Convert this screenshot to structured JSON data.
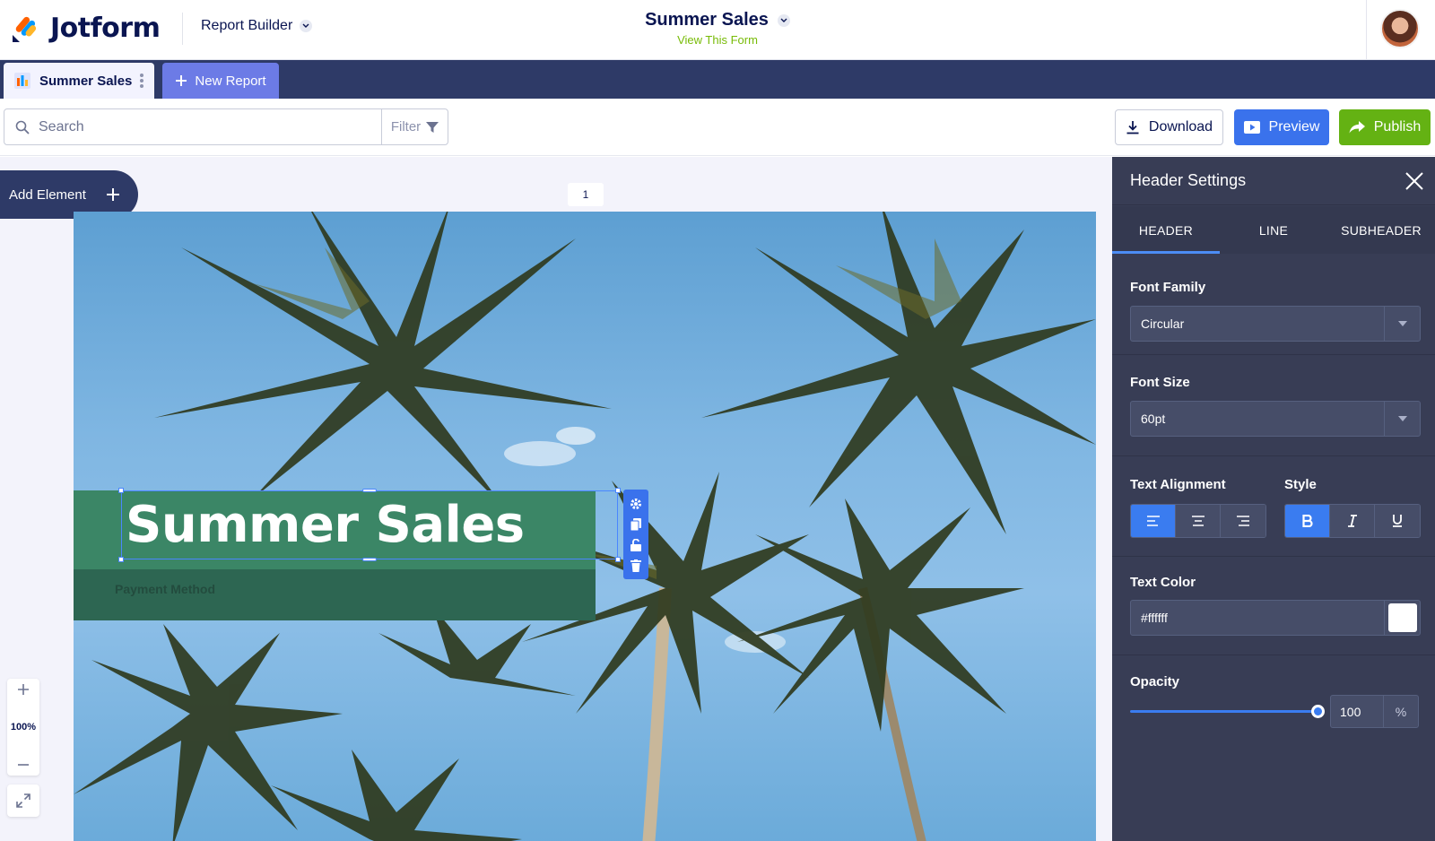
{
  "app": {
    "brand": "Jotform",
    "product_menu": "Report Builder",
    "form_title": "Summer Sales",
    "view_form_link": "View This Form"
  },
  "tabs": {
    "active_label": "Summer Sales",
    "new_label": "New Report"
  },
  "toolbar": {
    "search_placeholder": "Search",
    "filter_label": "Filter",
    "download_label": "Download",
    "preview_label": "Preview",
    "publish_label": "Publish"
  },
  "canvas": {
    "add_element_label": "Add Element",
    "page_number": "1",
    "header_text": "Summer Sales",
    "subheader_text": "Payment Method",
    "zoom_level": "100%"
  },
  "panel": {
    "title": "Header Settings",
    "tabs": [
      "HEADER",
      "LINE",
      "SUBHEADER"
    ],
    "active_tab": "HEADER",
    "font_family_label": "Font Family",
    "font_family_value": "Circular",
    "font_size_label": "Font Size",
    "font_size_value": "60pt",
    "text_alignment_label": "Text Alignment",
    "alignment_selected": "left",
    "style_label": "Style",
    "style_selected": "bold",
    "text_color_label": "Text Color",
    "text_color_value": "#ffffff",
    "opacity_label": "Opacity",
    "opacity_value": "100",
    "opacity_unit": "%"
  },
  "colors": {
    "brand_navy": "#0a1551",
    "tab_bar": "#2e3a67",
    "preview_blue": "#3a72ec",
    "publish_green": "#64b213",
    "header_band": "#3b8666",
    "panel_bg": "#383d55"
  }
}
